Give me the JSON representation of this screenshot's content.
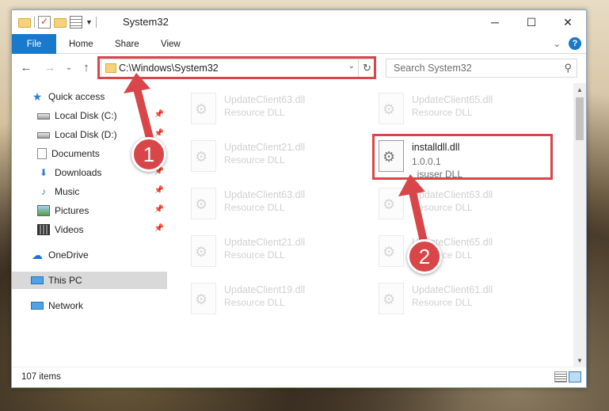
{
  "window": {
    "title": "System32",
    "controls": {
      "minimize": "─",
      "maximize": "☐",
      "close": "✕"
    }
  },
  "ribbon": {
    "tabs": [
      "File",
      "Home",
      "Share",
      "View"
    ],
    "collapse": "⌄",
    "help": "?"
  },
  "address": {
    "back": "←",
    "forward": "→",
    "recent": "⌄",
    "up": "↑",
    "path": "C:\\Windows\\System32",
    "dropdown": "⌄",
    "refresh": "↻"
  },
  "search": {
    "placeholder": "Search System32",
    "icon": "⚲"
  },
  "navpane": {
    "items": [
      {
        "label": "Quick access",
        "icon": "star-icon",
        "pinned": false
      },
      {
        "label": "Local Disk (C:)",
        "icon": "disk-icon",
        "pinned": true
      },
      {
        "label": "Local Disk (D:)",
        "icon": "disk-icon",
        "pinned": true
      },
      {
        "label": "Documents",
        "icon": "documents-icon",
        "pinned": true
      },
      {
        "label": "Downloads",
        "icon": "downloads-icon",
        "pinned": true
      },
      {
        "label": "Music",
        "icon": "music-icon",
        "pinned": true
      },
      {
        "label": "Pictures",
        "icon": "pictures-icon",
        "pinned": true
      },
      {
        "label": "Videos",
        "icon": "videos-icon",
        "pinned": true
      },
      {
        "label": "OneDrive",
        "icon": "onedrive-icon",
        "pinned": false
      },
      {
        "label": "This PC",
        "icon": "this-pc-icon",
        "pinned": false
      },
      {
        "label": "Network",
        "icon": "network-icon",
        "pinned": false
      }
    ],
    "pin_glyph": "📌"
  },
  "files": {
    "left": [
      {
        "name": "UpdateClient63.dll",
        "type": "Resource DLL"
      },
      {
        "name": "UpdateClient21.dll",
        "type": "Resource DLL"
      },
      {
        "name": "UpdateClient63.dll",
        "type": "Resource DLL"
      },
      {
        "name": "UpdateClient21.dll",
        "type": "Resource DLL"
      },
      {
        "name": "UpdateClient19.dll",
        "type": "Resource DLL"
      }
    ],
    "right": [
      {
        "name": "UpdateClient65.dll",
        "type": "Resource DLL"
      },
      {
        "name": "installdll.dll",
        "version": "1.0.0.1",
        "type": "_isuser DLL",
        "highlighted": true
      },
      {
        "name": "UpdateClient63.dll",
        "type": "Resource DLL"
      },
      {
        "name": "UpdateClient65.dll",
        "type": "Resource DLL"
      },
      {
        "name": "UpdateClient61.dll",
        "type": "Resource DLL"
      }
    ]
  },
  "status": {
    "item_count": "107 items"
  },
  "annotations": {
    "step1": "1",
    "step2": "2",
    "color": "#d9464a"
  },
  "colors": {
    "accent": "#1979ca",
    "highlight": "#d9464a",
    "selected_nav": "#d9d9d9"
  }
}
